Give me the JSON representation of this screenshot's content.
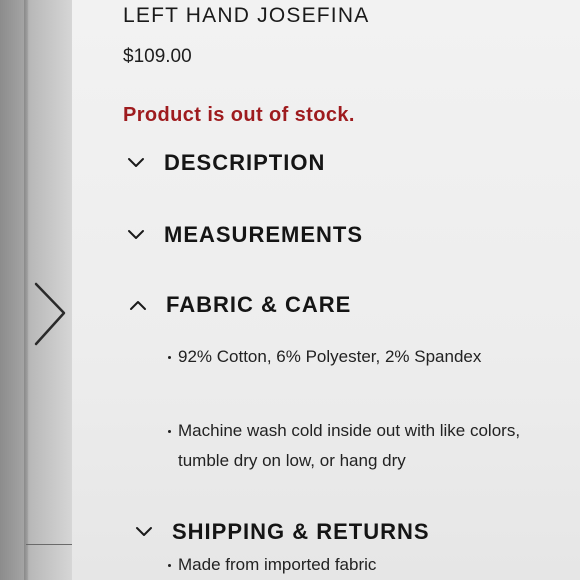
{
  "product": {
    "title": "LEFT HAND JOSEFINA",
    "price": "$109.00",
    "stock_status": "Product is out of stock."
  },
  "accordion": [
    {
      "label": "DESCRIPTION",
      "expanded": false,
      "icon": "chevron-down-icon"
    },
    {
      "label": "MEASUREMENTS",
      "expanded": false,
      "icon": "chevron-down-icon"
    },
    {
      "label": "FABRIC & CARE",
      "expanded": true,
      "icon": "chevron-up-icon",
      "items": [
        "92% Cotton, 6% Polyester, 2% Spandex",
        "Machine wash cold inside out with like colors, tumble dry on low, or hang dry",
        "Made from imported fabric"
      ]
    },
    {
      "label": "SHIPPING & RETURNS",
      "expanded": false,
      "icon": "chevron-down-icon"
    }
  ],
  "carousel": {
    "arrow_icon": "chevron-right-icon"
  },
  "colors": {
    "stock_status": "#9e1b1e",
    "text": "#151515",
    "background": "#eeeeee"
  }
}
